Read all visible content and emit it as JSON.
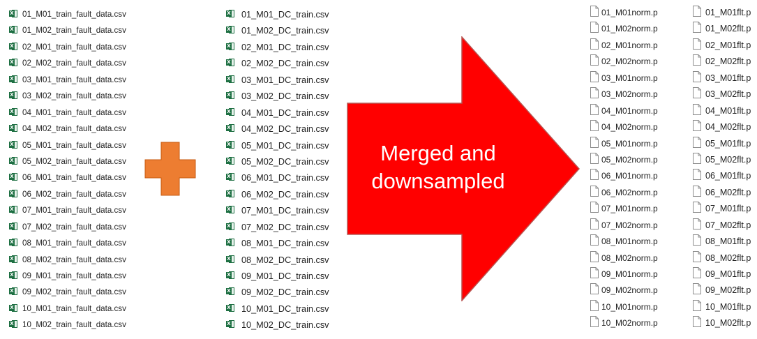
{
  "colors": {
    "arrow_fill": "#ff0000",
    "arrow_stroke": "#b85450",
    "plus_fill": "#ed7d31",
    "plus_stroke": "#c55a11",
    "excel_green": "#1d6f42"
  },
  "icons": {
    "excel_file": "excel-icon",
    "generic_file": "file-icon",
    "excel_badge_letter": "X"
  },
  "fault_files": [
    "01_M01_train_fault_data.csv",
    "01_M02_train_fault_data.csv",
    "02_M01_train_fault_data.csv",
    "02_M02_train_fault_data.csv",
    "03_M01_train_fault_data.csv",
    "03_M02_train_fault_data.csv",
    "04_M01_train_fault_data.csv",
    "04_M02_train_fault_data.csv",
    "05_M01_train_fault_data.csv",
    "05_M02_train_fault_data.csv",
    "06_M01_train_fault_data.csv",
    "06_M02_train_fault_data.csv",
    "07_M01_train_fault_data.csv",
    "07_M02_train_fault_data.csv",
    "08_M01_train_fault_data.csv",
    "08_M02_train_fault_data.csv",
    "09_M01_train_fault_data.csv",
    "09_M02_train_fault_data.csv",
    "10_M01_train_fault_data.csv",
    "10_M02_train_fault_data.csv"
  ],
  "dc_files": [
    "01_M01_DC_train.csv",
    "01_M02_DC_train.csv",
    "02_M01_DC_train.csv",
    "02_M02_DC_train.csv",
    "03_M01_DC_train.csv",
    "03_M02_DC_train.csv",
    "04_M01_DC_train.csv",
    "04_M02_DC_train.csv",
    "05_M01_DC_train.csv",
    "05_M02_DC_train.csv",
    "06_M01_DC_train.csv",
    "06_M02_DC_train.csv",
    "07_M01_DC_train.csv",
    "07_M02_DC_train.csv",
    "08_M01_DC_train.csv",
    "08_M02_DC_train.csv",
    "09_M01_DC_train.csv",
    "09_M02_DC_train.csv",
    "10_M01_DC_train.csv",
    "10_M02_DC_train.csv"
  ],
  "norm_files": [
    "01_M01norm.p",
    "01_M02norm.p",
    "02_M01norm.p",
    "02_M02norm.p",
    "03_M01norm.p",
    "03_M02norm.p",
    "04_M01norm.p",
    "04_M02norm.p",
    "05_M01norm.p",
    "05_M02norm.p",
    "06_M01norm.p",
    "06_M02norm.p",
    "07_M01norm.p",
    "07_M02norm.p",
    "08_M01norm.p",
    "08_M02norm.p",
    "09_M01norm.p",
    "09_M02norm.p",
    "10_M01norm.p",
    "10_M02norm.p"
  ],
  "flt_files": [
    "01_M01flt.p",
    "01_M02flt.p",
    "02_M01flt.p",
    "02_M02flt.p",
    "03_M01flt.p",
    "03_M02flt.p",
    "04_M01flt.p",
    "04_M02flt.p",
    "05_M01flt.p",
    "05_M02flt.p",
    "06_M01flt.p",
    "06_M02flt.p",
    "07_M01flt.p",
    "07_M02flt.p",
    "08_M01flt.p",
    "08_M02flt.p",
    "09_M01flt.p",
    "09_M02flt.p",
    "10_M01flt.p",
    "10_M02flt.p"
  ],
  "arrow_label": {
    "line1": "Merged and",
    "line2": "downsampled"
  }
}
